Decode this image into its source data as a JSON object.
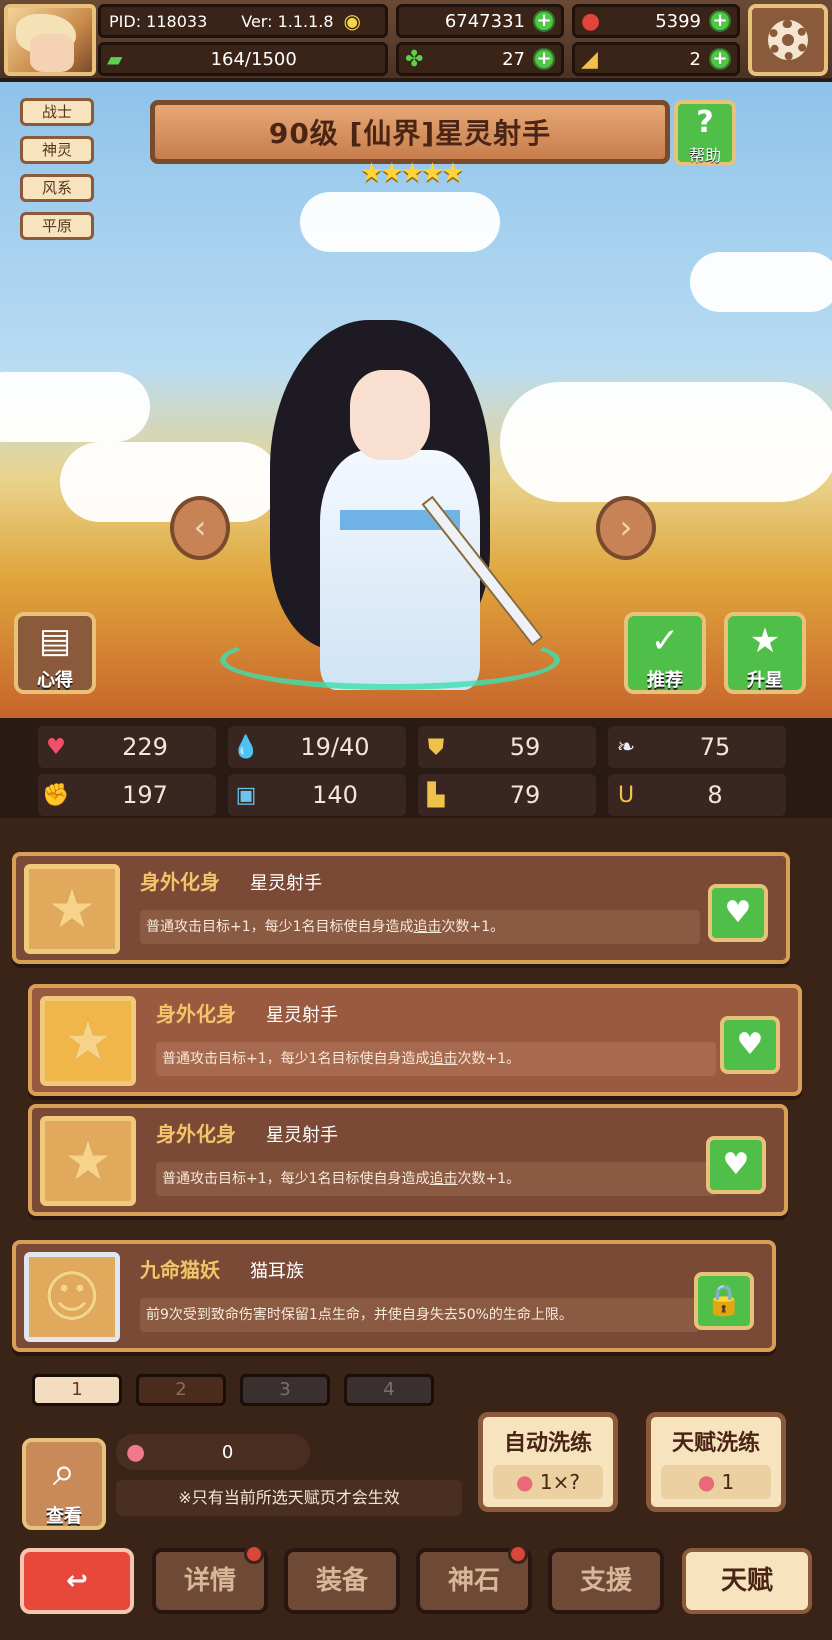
{
  "header": {
    "pid": "PID: 118033",
    "version": "Ver: 1.1.1.8",
    "gold": "6747331",
    "gems": "5399",
    "stamina": "164/1500",
    "clover": "27",
    "horn": "2"
  },
  "hero": {
    "title": "90级 [仙界]星灵射手",
    "stars": "★★★★★",
    "tags": [
      "战士",
      "神灵",
      "风系",
      "平原"
    ],
    "help_label": "帮助",
    "insight_label": "心得",
    "recommend_label": "推荐",
    "upgrade_label": "升星"
  },
  "stats": [
    {
      "icon": "heart-icon",
      "value": "229"
    },
    {
      "icon": "water-icon",
      "value": "19/40"
    },
    {
      "icon": "shield-icon",
      "value": "59"
    },
    {
      "icon": "wing-icon",
      "value": "75"
    },
    {
      "icon": "fist-icon",
      "value": "197"
    },
    {
      "icon": "book-icon",
      "value": "140"
    },
    {
      "icon": "boot-icon",
      "value": "79"
    },
    {
      "icon": "horseshoe-icon",
      "value": "8"
    }
  ],
  "talents": [
    {
      "name": "身外化身",
      "race": "星灵射手",
      "desc_a": "普通攻击目标+1，每少1名目标使自身造成",
      "desc_link": "追击",
      "desc_b": "次数+1。"
    },
    {
      "name": "身外化身",
      "race": "星灵射手",
      "desc_a": "普通攻击目标+1，每少1名目标使自身造成",
      "desc_link": "追击",
      "desc_b": "次数+1。"
    },
    {
      "name": "身外化身",
      "race": "星灵射手",
      "desc_a": "普通攻击目标+1，每少1名目标使自身造成",
      "desc_link": "追击",
      "desc_b": "次数+1。"
    },
    {
      "name": "九命猫妖",
      "race": "猫耳族",
      "desc_a": "前9次受到致命伤害时保留1点生命，并使自身失去50%的生命上限。",
      "desc_link": "",
      "desc_b": ""
    }
  ],
  "pages": [
    "1",
    "2",
    "3",
    "4"
  ],
  "footer": {
    "peach_count": "0",
    "note": "※只有当前所选天赋页才会生效",
    "view_label": "查看",
    "auto_refine_label": "自动洗练",
    "auto_refine_cost": "1×?",
    "talent_refine_label": "天赋洗练",
    "talent_refine_cost": "1"
  },
  "nav": {
    "details": "详情",
    "equipment": "装备",
    "divine_stone": "神石",
    "support": "支援",
    "talent": "天赋"
  }
}
